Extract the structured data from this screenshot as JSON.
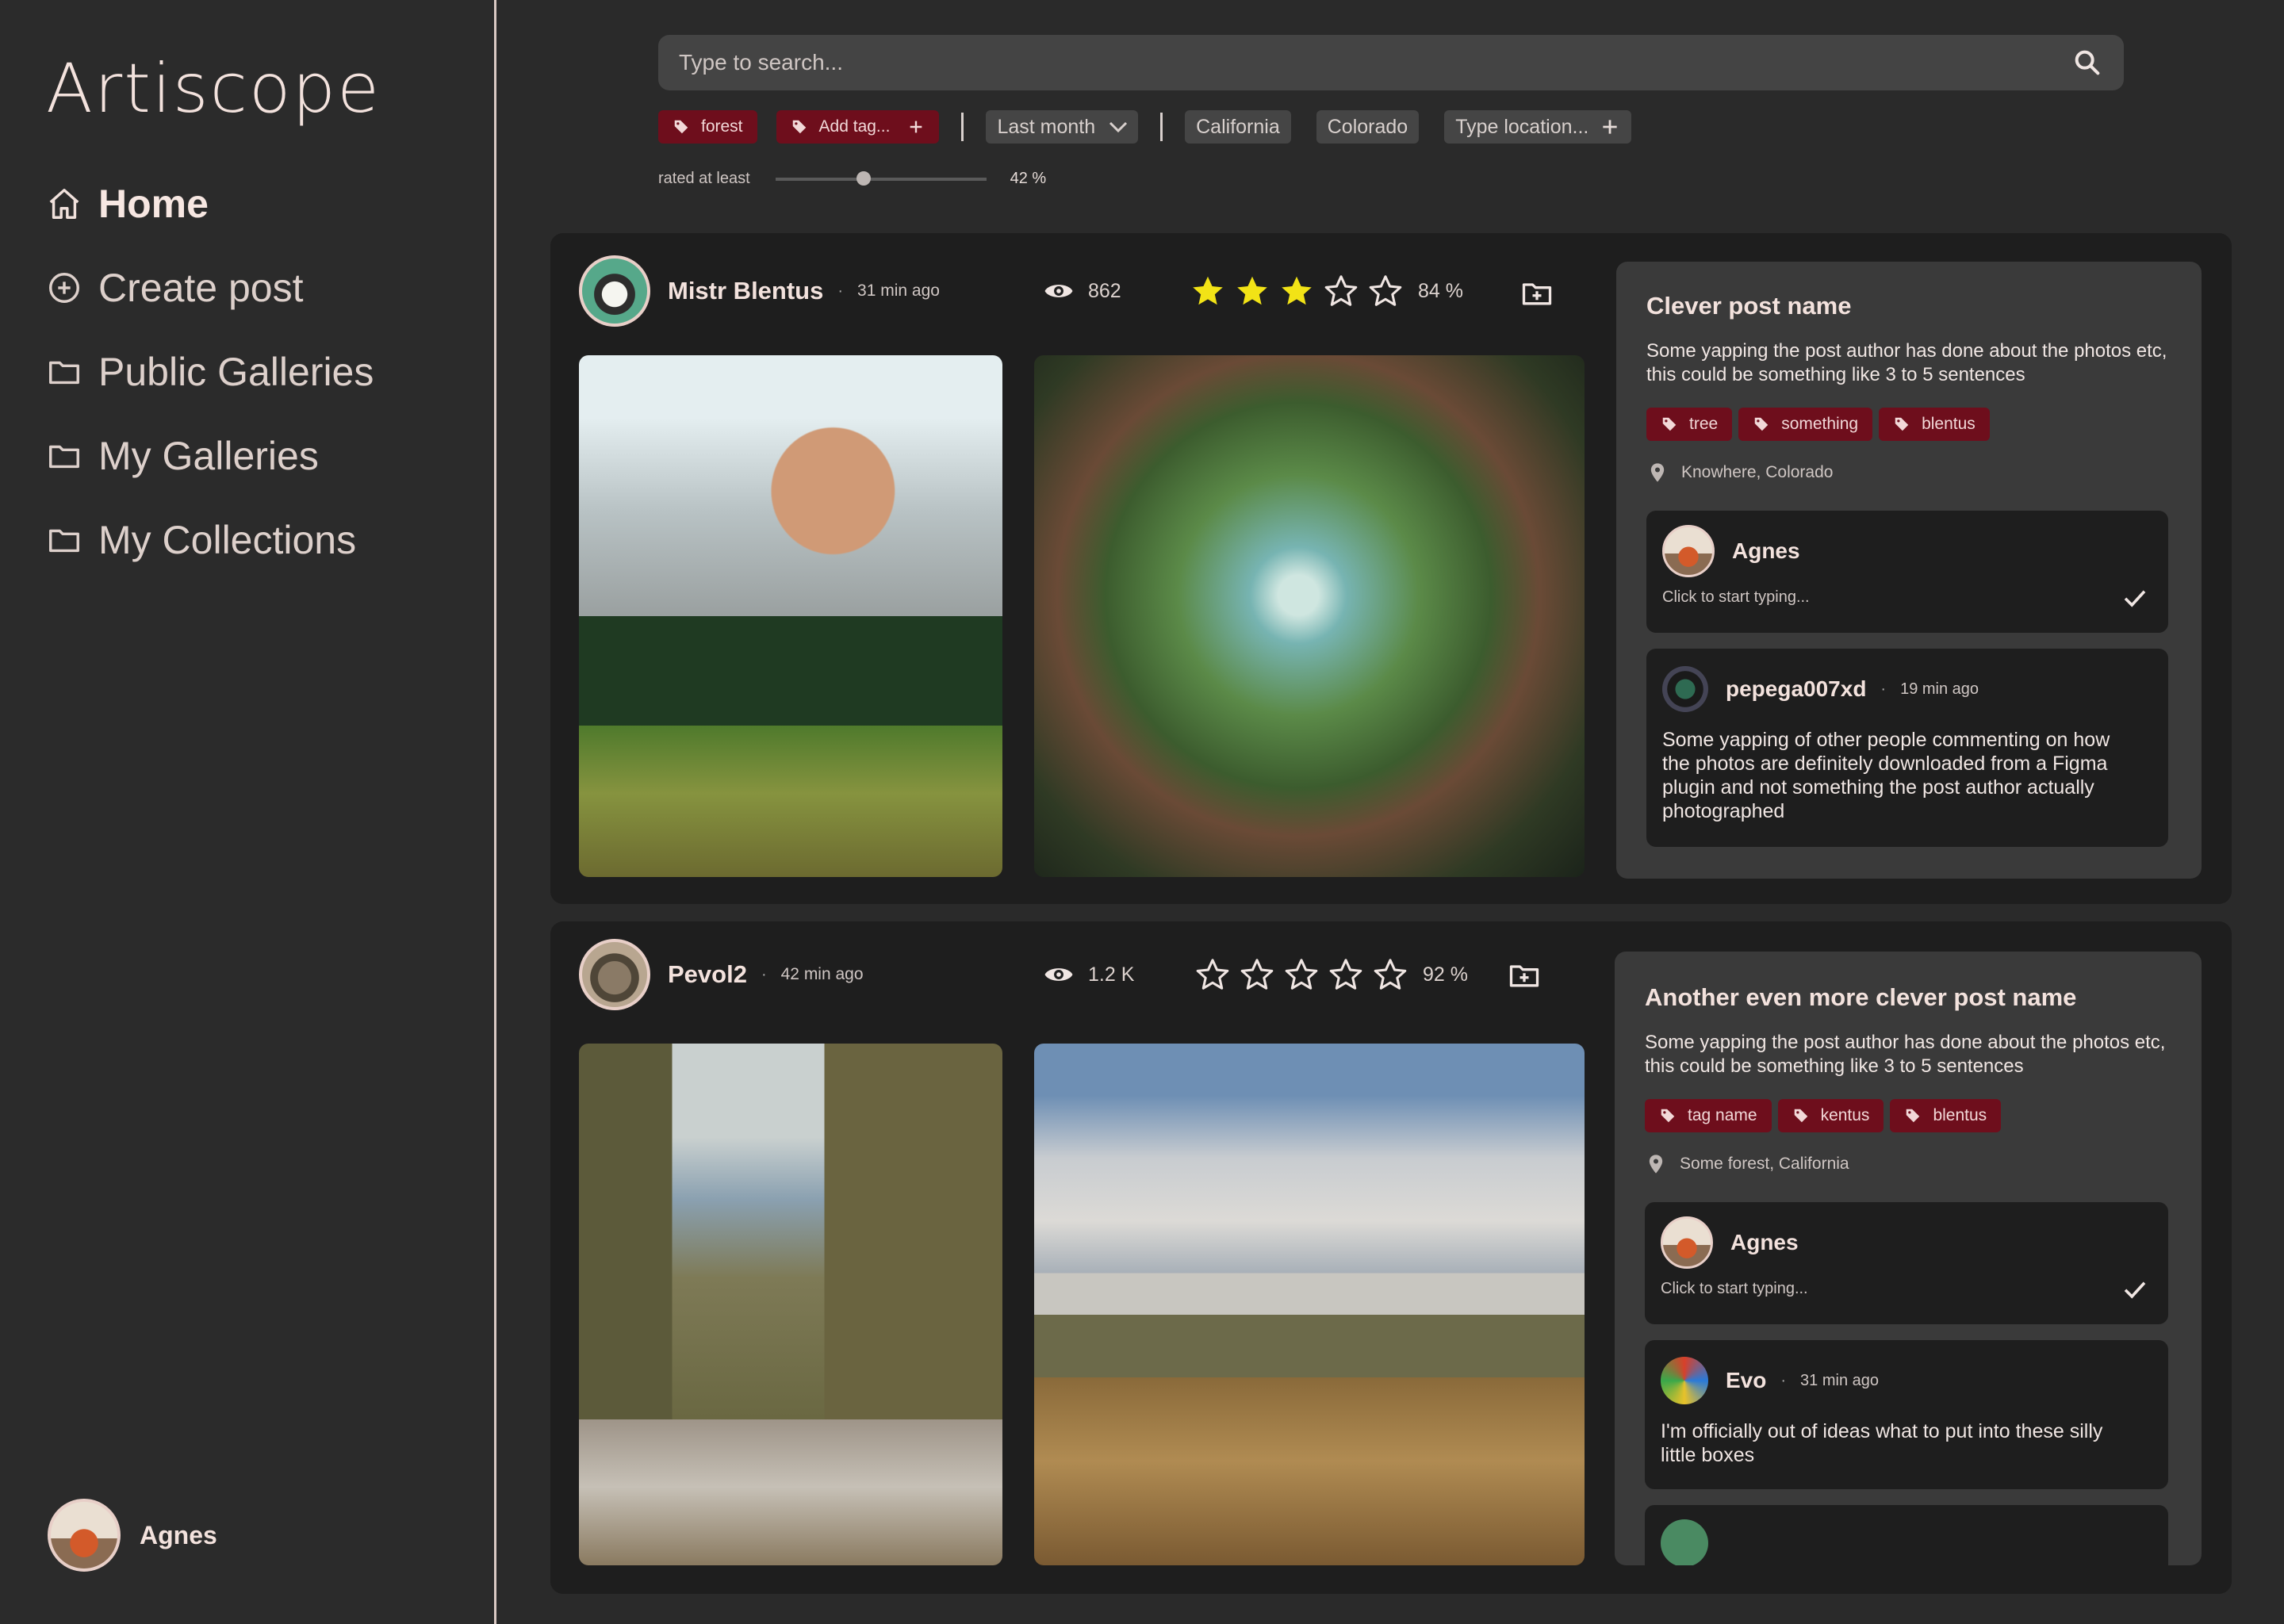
{
  "app": {
    "logo": "Artiscope"
  },
  "nav": [
    {
      "label": "Home",
      "icon": "home-icon",
      "active": true
    },
    {
      "label": "Create post",
      "icon": "plus-circle-icon"
    },
    {
      "label": "Public Galleries",
      "icon": "folder-icon"
    },
    {
      "label": "My Galleries",
      "icon": "folder-icon"
    },
    {
      "label": "My Collections",
      "icon": "folder-icon"
    }
  ],
  "current_user": {
    "name": "Agnes"
  },
  "search": {
    "placeholder": "Type to search..."
  },
  "filters": {
    "tags": [
      "forest"
    ],
    "add_tag_label": "Add tag...",
    "time_range": "Last month",
    "locations": [
      "California",
      "Colorado"
    ],
    "location_placeholder": "Type location...",
    "rating_label": "rated at least",
    "rating_min_percent": 42,
    "rating_min_display": "42 %"
  },
  "posts": [
    {
      "author": "Mistr Blentus",
      "time": "31 min ago",
      "views": "862",
      "stars": 3,
      "rating": "84 %",
      "title": "Clever post name",
      "description": "Some yapping the post author has done about the photos etc, this could be something like 3 to 5 sentences",
      "tags": [
        "tree",
        "something",
        "blentus"
      ],
      "location": "Knowhere, Colorado",
      "reply_author": "Agnes",
      "reply_placeholder": "Click to start typing...",
      "comments": [
        {
          "author": "pepega007xd",
          "time": "19 min ago",
          "text": "Some yapping of other people commenting on how the photos are definitely downloaded from a Figma plugin and not something the post author actually photographed"
        }
      ]
    },
    {
      "author": "Pevol2",
      "time": "42 min ago",
      "views": "1.2 K",
      "stars": 0,
      "rating": "92 %",
      "title": "Another even more clever post name",
      "description": "Some yapping the post author has done about the photos etc, this could be something like 3 to 5 sentences",
      "tags": [
        "tag name",
        "kentus",
        "blentus"
      ],
      "location": "Some forest, California",
      "reply_author": "Agnes",
      "reply_placeholder": "Click to start typing...",
      "comments": [
        {
          "author": "Evo",
          "time": "31 min ago",
          "text": "I'm officially out of ideas what to put into these silly little boxes"
        }
      ]
    }
  ],
  "colors": {
    "background": "#2a2a2a",
    "card": "#1e1e1e",
    "panel": "#3a3a3a",
    "tag": "#6e0e1c",
    "star_filled": "#f2e316",
    "text": "#f0e1dc"
  }
}
